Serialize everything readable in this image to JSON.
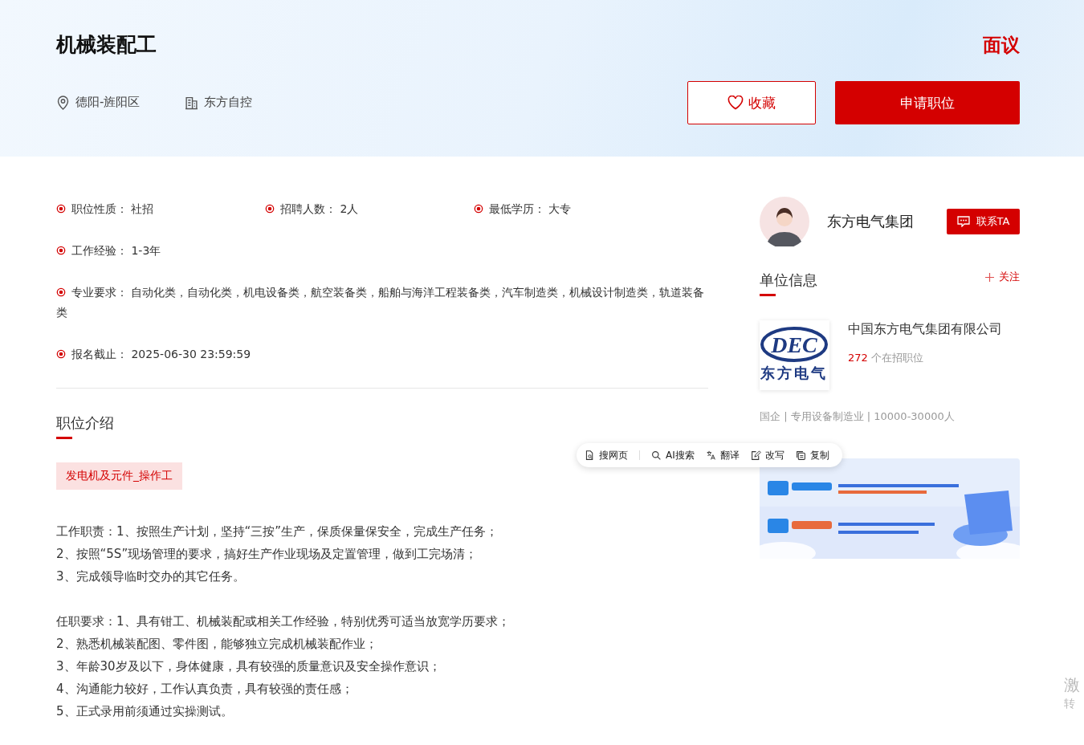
{
  "header": {
    "title": "机械装配工",
    "salary": "面议",
    "location": "德阳-旌阳区",
    "company": "东方自控",
    "favorite_button": "收藏",
    "apply_button": "申请职位"
  },
  "attributes": [
    {
      "label": "职位性质：",
      "value": "社招",
      "kind": "short"
    },
    {
      "label": "招聘人数：",
      "value": "2人",
      "kind": "short"
    },
    {
      "label": "最低学历：",
      "value": "大专",
      "kind": "short"
    },
    {
      "label": "工作经验：",
      "value": "1-3年",
      "kind": "wide"
    },
    {
      "label": "专业要求：",
      "value": "自动化类，自动化类，机电设备类，航空装备类，船舶与海洋工程装备类，汽车制造类，机械设计制造类，轨道装备类",
      "kind": "wide"
    },
    {
      "label": "报名截止：",
      "value": "2025-06-30 23:59:59",
      "kind": "wide"
    }
  ],
  "intro": {
    "title": "职位介绍",
    "tag": "发电机及元件_操作工",
    "paragraphs": [
      [
        "工作职责：1、按照生产计划，坚持“三按”生产，保质保量保安全，完成生产任务；",
        "2、按照“5S”现场管理的要求，搞好生产作业现场及定置管理，做到工完场清；",
        "3、完成领导临时交办的其它任务。"
      ],
      [
        "任职要求：1、具有钳工、机械装配或相关工作经验，特别优秀可适当放宽学历要求；",
        "2、熟悉机械装配图、零件图，能够独立完成机械装配作业；",
        "3、年龄30岁及以下，身体健康，具有较强的质量意识及安全操作意识；",
        "4、沟通能力较好，工作认真负责，具有较强的责任感；",
        "5、正式录用前须通过实操测试。"
      ]
    ]
  },
  "sidebar": {
    "contact_name": "东方电气集团",
    "contact_button": "联系TA",
    "unit_title": "单位信息",
    "follow_button": "关注",
    "logo_text": "DEC",
    "logo_subtext": "东方电气",
    "company_name": "中国东方电气集团有限公司",
    "job_count": "272",
    "job_count_suffix": "个在招职位",
    "company_meta": "国企 | 专用设备制造业 | 10000-30000人"
  },
  "toolbar": [
    {
      "label": "搜网页",
      "kind": "page"
    },
    {
      "label": "AI搜索",
      "kind": "search"
    },
    {
      "label": "翻译",
      "kind": "translate"
    },
    {
      "label": "改写",
      "kind": "edit"
    },
    {
      "label": "复制",
      "kind": "copy"
    }
  ],
  "watermark": [
    "激",
    "转"
  ]
}
